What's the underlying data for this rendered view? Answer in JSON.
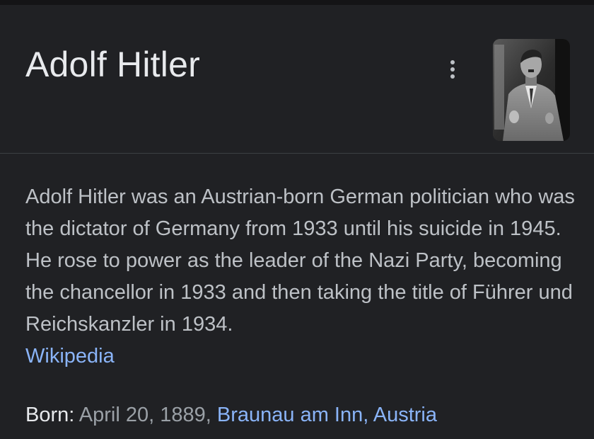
{
  "entity": {
    "title": "Adolf Hitler",
    "menu_icon": "more-vert-icon",
    "thumbnail_icon": "portrait-photo"
  },
  "description": {
    "text": "Adolf Hitler was an Austrian-born German politician who was the dictator of Germany from 1933 until his suicide in 1945. He rose to power as the leader of the Nazi Party, becoming the chancellor in 1933 and then taking the title of Führer und Reichskanzler in 1934.",
    "source_label": "Wikipedia"
  },
  "facts": {
    "born": {
      "label": "Born:",
      "date": "April 20, 1889,",
      "place": "Braunau am Inn, Austria"
    }
  },
  "colors": {
    "background": "#202124",
    "title_text": "#e8eaed",
    "body_text": "#bdc1c6",
    "link": "#8ab4f8",
    "divider": "#3c4043"
  }
}
